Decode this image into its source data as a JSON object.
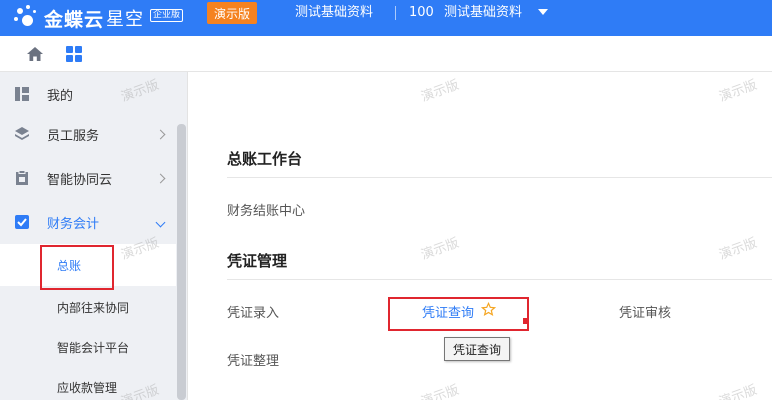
{
  "header": {
    "logo_text": "金蝶云",
    "logo_sub": "星空",
    "edition": "企业版",
    "demo_badge": "演示版",
    "org_name": "测试基础资料",
    "account_number": "100",
    "account_name": "测试基础资料"
  },
  "sidebar": {
    "items": [
      {
        "label": "我的",
        "icon": "bookmark-icon"
      },
      {
        "label": "员工服务",
        "icon": "layers-icon"
      },
      {
        "label": "智能协同云",
        "icon": "clipboard-icon"
      },
      {
        "label": "财务会计",
        "icon": "checkbox-icon"
      }
    ],
    "sub_items": [
      {
        "label": "总账"
      },
      {
        "label": "内部往来协同"
      },
      {
        "label": "智能会计平台"
      },
      {
        "label": "应收款管理"
      }
    ]
  },
  "main": {
    "section1": {
      "title": "总账工作台",
      "links": [
        "财务结账中心"
      ]
    },
    "section2": {
      "title": "凭证管理",
      "links": [
        "凭证录入",
        "凭证查询",
        "凭证审核",
        "凭证整理"
      ]
    },
    "tooltip": "凭证查询"
  },
  "watermark": "演示版",
  "colors": {
    "brand": "#2f7cf6",
    "badge": "#f58220",
    "highlight": "#e0262f",
    "star": "#f5a623"
  }
}
